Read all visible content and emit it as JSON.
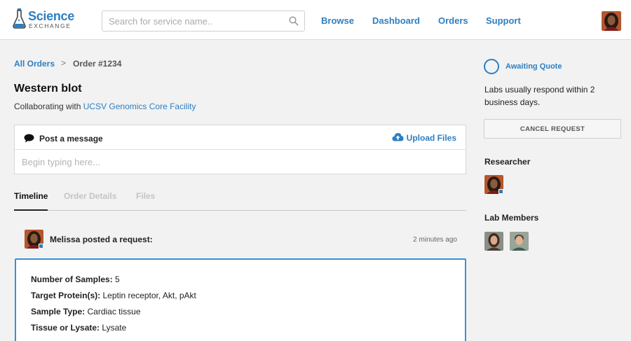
{
  "header": {
    "logo": {
      "line1": "Science",
      "line2": "EXCHANGE"
    },
    "search": {
      "placeholder": "Search for service name.."
    },
    "nav": [
      {
        "label": "Browse"
      },
      {
        "label": "Dashboard"
      },
      {
        "label": "Orders"
      },
      {
        "label": "Support"
      }
    ]
  },
  "breadcrumb": {
    "link": "All Orders",
    "separator": ">",
    "current": "Order #1234"
  },
  "order": {
    "title": "Western blot",
    "collaborating_prefix": "Collaborating with",
    "collaborator": "UCSV Genomics Core Facility"
  },
  "message": {
    "header_label": "Post a message",
    "upload_label": "Upload Files",
    "placeholder": "Begin typing here..."
  },
  "tabs": [
    {
      "label": "Timeline",
      "active": true
    },
    {
      "label": "Order Details",
      "active": false
    },
    {
      "label": "Files",
      "active": false
    }
  ],
  "timeline": {
    "entry_text": "Melissa posted a request:",
    "time": "2 minutes ago",
    "fields": [
      {
        "label": "Number of Samples:",
        "value": "5"
      },
      {
        "label": "Target Protein(s):",
        "value": "Leptin receptor, Akt, pAkt"
      },
      {
        "label": "Sample Type:",
        "value": "Cardiac tissue"
      },
      {
        "label": "Tissue or Lysate:",
        "value": "Lysate"
      }
    ]
  },
  "sidebar": {
    "status": "Awaiting Quote",
    "status_note": "Labs usually respond within 2 business days.",
    "cancel_label": "CANCEL REQUEST",
    "researcher_heading": "Researcher",
    "lab_members_heading": "Lab Members"
  },
  "colors": {
    "accent": "#2c7fc2",
    "background": "#f2f2f2"
  }
}
